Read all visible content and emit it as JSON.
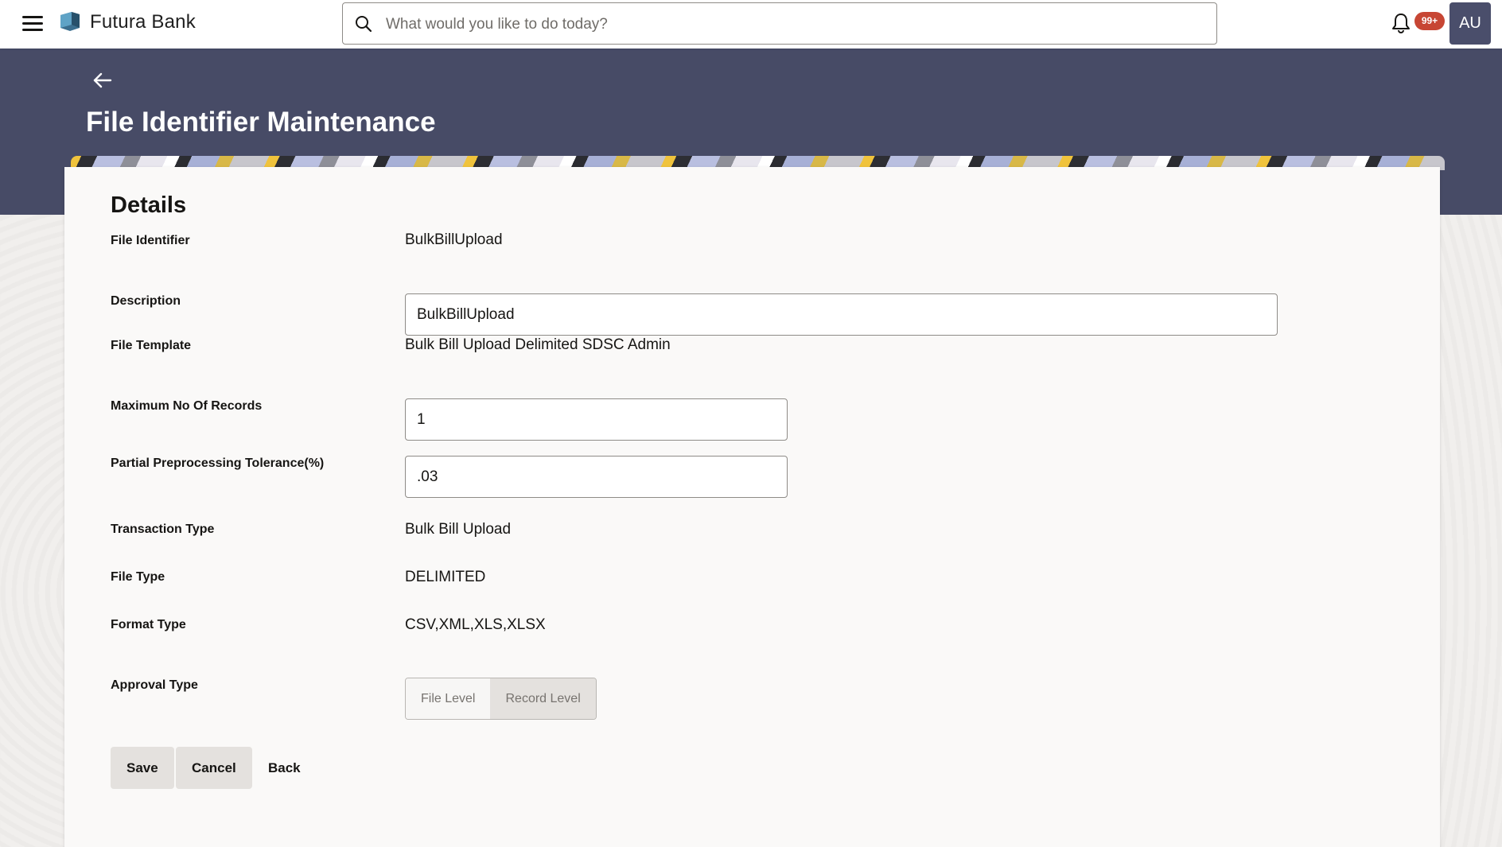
{
  "header": {
    "brand": "Futura Bank",
    "search_placeholder": "What would you like to do today?",
    "notification_count": "99+",
    "avatar_initials": "AU"
  },
  "page": {
    "title": "File Identifier Maintenance"
  },
  "details": {
    "section_title": "Details",
    "file_identifier_label": "File Identifier",
    "file_identifier_value": "BulkBillUpload",
    "description_label": "Description",
    "description_value": "BulkBillUpload",
    "file_template_label": "File Template",
    "file_template_value": "Bulk Bill Upload Delimited SDSC Admin",
    "max_records_label": "Maximum No Of Records",
    "max_records_value": "1",
    "tolerance_label": "Partial Preprocessing Tolerance(%)",
    "tolerance_value": ".03",
    "transaction_type_label": "Transaction Type",
    "transaction_type_value": "Bulk Bill Upload",
    "file_type_label": "File Type",
    "file_type_value": "DELIMITED",
    "format_type_label": "Format Type",
    "format_type_value": "CSV,XML,XLS,XLSX",
    "approval_type_label": "Approval Type",
    "approval_options": [
      "File Level",
      "Record Level"
    ]
  },
  "actions": {
    "save_label": "Save",
    "cancel_label": "Cancel",
    "back_label": "Back"
  },
  "colors": {
    "banner": "#474b66",
    "avatar": "#4a4e6b",
    "badge": "#c74634"
  }
}
